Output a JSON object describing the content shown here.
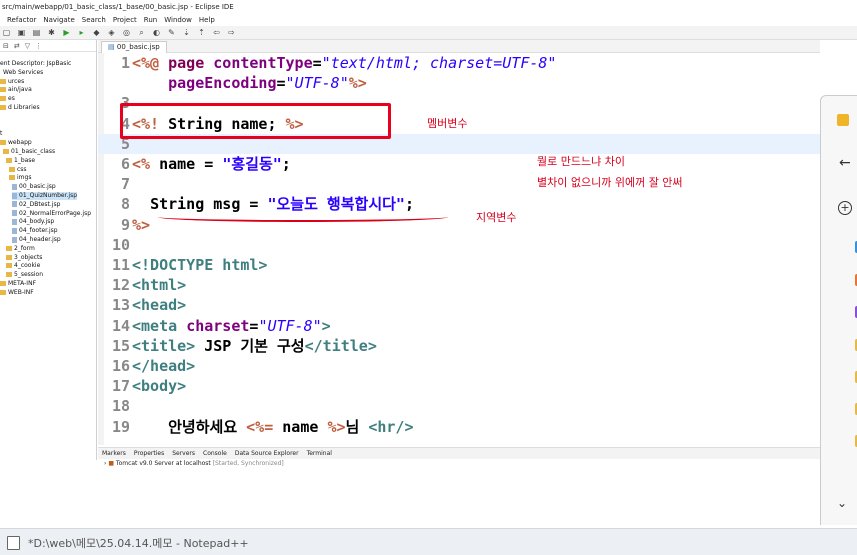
{
  "window": {
    "title": "src/main/webapp/01_basic_class/1_base/00_basic.jsp - Eclipse IDE"
  },
  "menu": [
    "Refactor",
    "Navigate",
    "Search",
    "Project",
    "Run",
    "Window",
    "Help"
  ],
  "explorer": {
    "items": [
      {
        "label": "ent Descriptor: JspBasic",
        "icon": "descriptor"
      },
      {
        "label": "Web Services",
        "icon": "service"
      },
      {
        "label": "urces",
        "icon": "folder"
      },
      {
        "label": "ain/java",
        "icon": "folder"
      },
      {
        "label": "es",
        "icon": "folder"
      },
      {
        "label": "d Libraries",
        "icon": "folder"
      },
      {
        "label": "",
        "icon": "none"
      },
      {
        "label": "",
        "icon": "none"
      },
      {
        "label": "t",
        "icon": "none"
      },
      {
        "label": "webapp",
        "icon": "folder"
      },
      {
        "label": "01_basic_class",
        "icon": "folder"
      },
      {
        "label": "1_base",
        "icon": "folder"
      },
      {
        "label": "css",
        "icon": "folder"
      },
      {
        "label": "imgs",
        "icon": "folder"
      },
      {
        "label": "00_basic.jsp",
        "icon": "file"
      },
      {
        "label": "01_QuizNumber.jsp",
        "icon": "file",
        "selected": true
      },
      {
        "label": "02_DBtest.jsp",
        "icon": "file"
      },
      {
        "label": "02_NormalErrorPage.jsp",
        "icon": "file"
      },
      {
        "label": "04_body.jsp",
        "icon": "file"
      },
      {
        "label": "04_footer.jsp",
        "icon": "file"
      },
      {
        "label": "04_header.jsp",
        "icon": "file"
      },
      {
        "label": "2_form",
        "icon": "folder"
      },
      {
        "label": "3_objects",
        "icon": "folder"
      },
      {
        "label": "4_cookie",
        "icon": "folder"
      },
      {
        "label": "5_session",
        "icon": "folder"
      },
      {
        "label": "META-INF",
        "icon": "folder"
      },
      {
        "label": "WEB-INF",
        "icon": "folder"
      }
    ]
  },
  "editor": {
    "tab_label": "00_basic.jsp",
    "lines": [
      {
        "num": "1",
        "html": "<span class='d'>&lt;%@</span> <span class='k'>page</span> <span class='a'>contentType</span>=<span class='si'>\"text/html; charset=UTF-8\"</span>"
      },
      {
        "num": "",
        "html": "    <span class='a'>pageEncoding</span>=<span class='si'>\"UTF-8\"</span><span class='d'>%&gt;</span>"
      },
      {
        "num": "3",
        "html": ""
      },
      {
        "num": "4",
        "html": "<span class='d'>&lt;%!</span> <span class='p'>String name;</span> <span class='d'>%&gt;</span>"
      },
      {
        "num": "5",
        "html": "",
        "current": true
      },
      {
        "num": "6",
        "html": "<span class='d'>&lt;%</span> <span class='p'>name = </span><span class='s'>\"홍길동\"</span><span class='p'>;</span>"
      },
      {
        "num": "7",
        "html": ""
      },
      {
        "num": "8",
        "html": "  <span class='p'>String msg = </span><span class='s'>\"오늘도 행복합시다\"</span><span class='p'>;</span>"
      },
      {
        "num": "9",
        "html": "<span class='d'>%&gt;</span>"
      },
      {
        "num": "10",
        "html": ""
      },
      {
        "num": "11",
        "html": "<span class='t'>&lt;!DOCTYPE html&gt;</span>"
      },
      {
        "num": "12",
        "html": "<span class='t'>&lt;html&gt;</span>"
      },
      {
        "num": "13",
        "html": "<span class='t'>&lt;head&gt;</span>"
      },
      {
        "num": "14",
        "html": "<span class='t'>&lt;meta</span> <span class='a'>charset</span>=<span class='si'>\"UTF-8\"</span><span class='t'>&gt;</span>"
      },
      {
        "num": "15",
        "html": "<span class='t'>&lt;title&gt;</span><span class='p'> JSP 기본 구성</span><span class='t'>&lt;/title&gt;</span>"
      },
      {
        "num": "16",
        "html": "<span class='t'>&lt;/head&gt;</span>"
      },
      {
        "num": "17",
        "html": "<span class='t'>&lt;body&gt;</span>"
      },
      {
        "num": "18",
        "html": ""
      },
      {
        "num": "19",
        "html": "    <span class='p'>안녕하세요 </span><span class='d'>&lt;%=</span> <span class='p'>name</span> <span class='d'>%&gt;</span><span class='p'>님 </span><span class='t'>&lt;hr/&gt;</span>"
      }
    ]
  },
  "annotations": {
    "member_var": "멤버변수",
    "question": "뭘로 만드느냐 차이",
    "answer": "별차이 없으니까 위에꺼 잘 안써",
    "local_var": "지역변수"
  },
  "bottom_tabs": [
    "Markers",
    "Properties",
    "Servers",
    "Console",
    "Data Source Explorer",
    "Terminal"
  ],
  "server": {
    "name": "Tomcat v9.0 Server at localhost",
    "status": "[Started, Synchronized]"
  },
  "taskbar": {
    "app_label": "*D:\\web\\메모\\25.04.14.메모 - Notepad++"
  }
}
